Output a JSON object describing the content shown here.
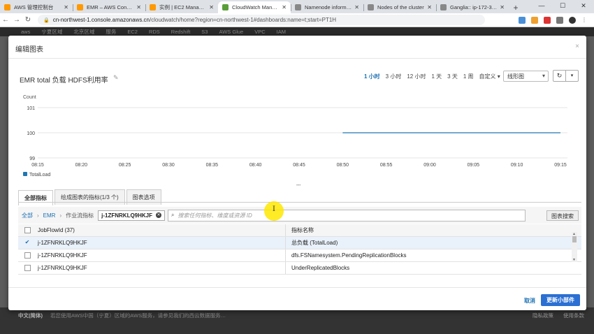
{
  "browser": {
    "tabs": [
      {
        "title": "AWS 管理控制台",
        "color": "#f90",
        "active": false
      },
      {
        "title": "EMR – AWS Console",
        "color": "#f90",
        "active": false
      },
      {
        "title": "实例 | EC2 Managem…",
        "color": "#f90",
        "active": false
      },
      {
        "title": "CloudWatch Manag…",
        "color": "#5a9e3a",
        "active": true
      },
      {
        "title": "Namenode informati…",
        "color": "#888",
        "active": false
      },
      {
        "title": "Nodes of the cluster",
        "color": "#888",
        "active": false
      },
      {
        "title": "Ganglia:: ip-172-31-…",
        "color": "#888",
        "active": false
      }
    ],
    "url_domain": "cn-northwest-1.console.amazonaws.cn",
    "url_path": "/cloudwatch/home?region=cn-northwest-1#dashboards:name=t;start=PT1H"
  },
  "aws_header": [
    "aws",
    "宁夏区域",
    "北京区域",
    "服务",
    "EC2",
    "RDS",
    "Redshift",
    "S3",
    "AWS Glue",
    "VPC",
    "IAM"
  ],
  "footer": {
    "lang": "中文(简体)",
    "text": "若您使用AWS中国（宁夏）区域的AWS服务，请参见我们的西云数据服务…",
    "right1": "隐私政策",
    "right2": "使用条款"
  },
  "modal": {
    "title": "编辑图表",
    "close": "×",
    "chart_title": "EMR total 负载 HDFS利用率",
    "time_ranges": [
      "1 小时",
      "3 小时",
      "12 小时",
      "1 天",
      "3 天",
      "1 周",
      "自定义 ▾"
    ],
    "selected_range": "1 小时",
    "chart_type": "线形图",
    "tabs": [
      "全部指标",
      "绘成图表的指标(1/3 个)",
      "图表选项"
    ],
    "breadcrumb": {
      "all": "全部",
      "ns": "EMR",
      "dim": "作业流指标"
    },
    "token": "j-1ZFNRKLQ9HKJF",
    "search_placeholder": "搜索任何指标、维度或资源 ID",
    "graph_search": "图表搜索",
    "table": {
      "headers": [
        "JobFlowId (37)",
        "指标名称"
      ],
      "rows": [
        {
          "id": "j-1ZFNRKLQ9HKJF",
          "metric": "总负载 (TotalLoad)",
          "checked": true
        },
        {
          "id": "j-1ZFNRKLQ9HKJF",
          "metric": "dfs.FSNamesystem.PendingReplicationBlocks",
          "checked": false
        },
        {
          "id": "j-1ZFNRKLQ9HKJF",
          "metric": "UnderReplicatedBlocks",
          "checked": false
        }
      ]
    },
    "cancel": "取消",
    "update": "更新小部件"
  },
  "chart_data": {
    "type": "line",
    "ylabel": "Count",
    "ylim": [
      99,
      101
    ],
    "yticks": [
      99,
      100,
      101
    ],
    "xticks": [
      "08:15",
      "08:20",
      "08:25",
      "08:30",
      "08:35",
      "08:40",
      "08:45",
      "08:50",
      "08:55",
      "09:00",
      "09:05",
      "09:10",
      "09:15"
    ],
    "series": [
      {
        "name": "TotalLoad",
        "color": "#1f77b4",
        "x": [
          "08:50",
          "09:15"
        ],
        "values": [
          100,
          100
        ]
      }
    ],
    "legend": "bottom-left",
    "grid": "horizontal"
  }
}
